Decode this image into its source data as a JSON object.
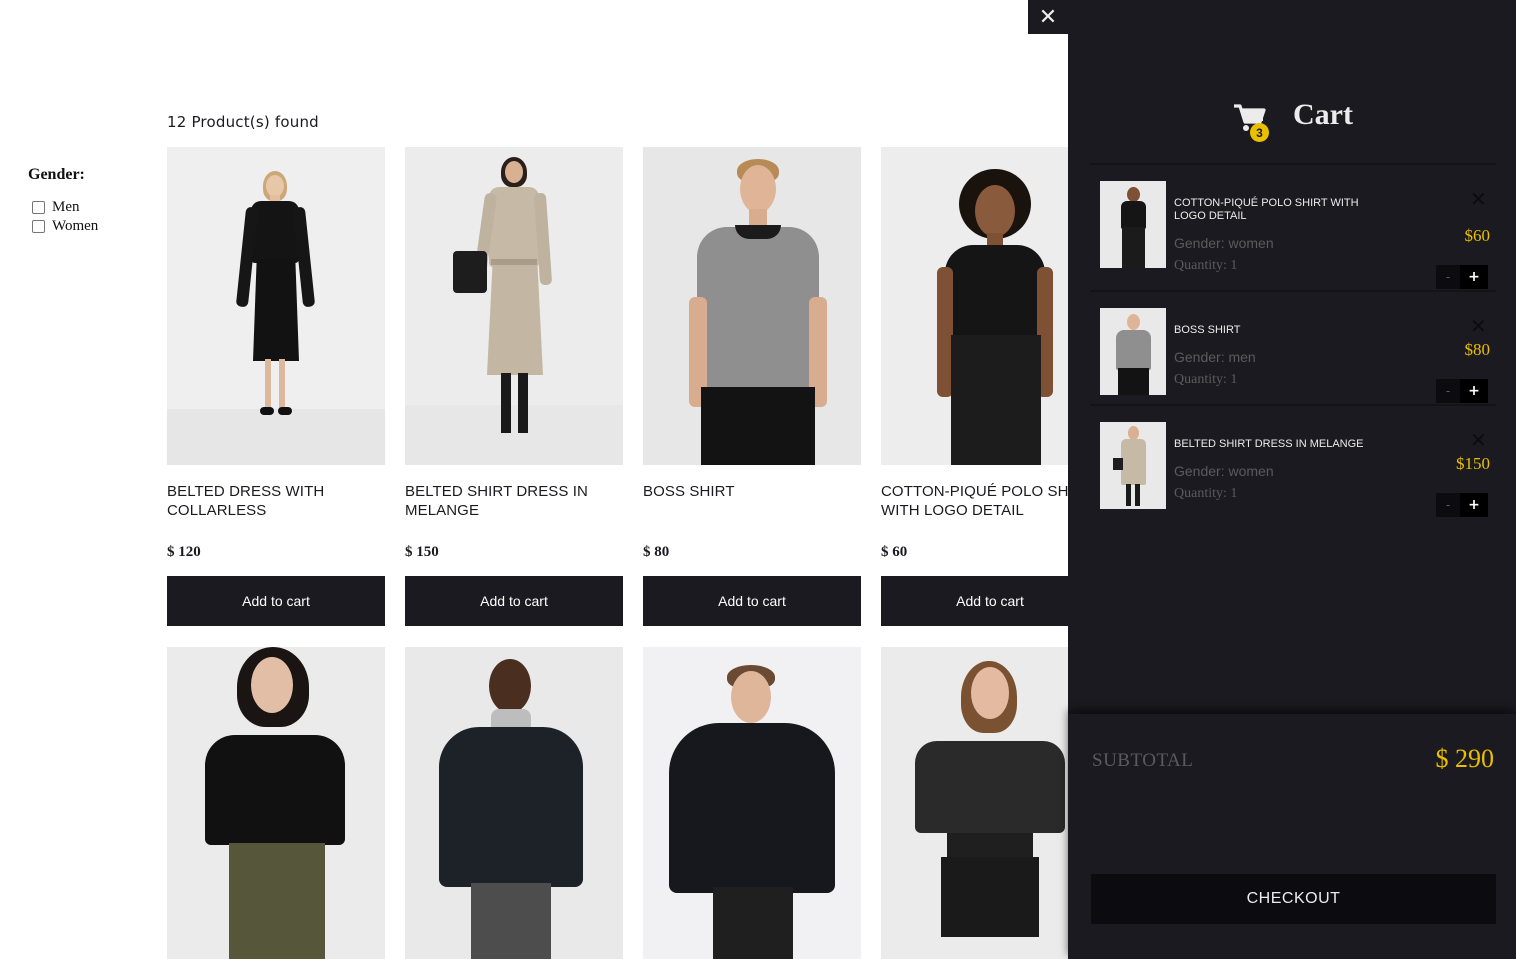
{
  "filter": {
    "title": "Gender:",
    "options": [
      "Men",
      "Women"
    ]
  },
  "products_found": "12 Product(s) found",
  "products": [
    {
      "title": "Belted dress with collarless",
      "price": "$ 120",
      "button": "Add to cart"
    },
    {
      "title": "Belted shirt dress in melange",
      "price": "$ 150",
      "button": "Add to cart"
    },
    {
      "title": "BOSS shirt",
      "price": "$ 80",
      "button": "Add to cart"
    },
    {
      "title": "Cotton-piqué polo shirt with logo detail",
      "price": "$ 60",
      "button": "Add to cart"
    }
  ],
  "cart": {
    "close_icon": "✕",
    "title": "Cart",
    "count": "3",
    "items": [
      {
        "title": "Cotton-piqué polo shirt with logo detail",
        "gender": "Gender: women",
        "quantity": "Quantity: 1",
        "price": "$60",
        "minus": "-",
        "plus": "+",
        "remove": "✕"
      },
      {
        "title": "BOSS shirt",
        "gender": "Gender: men",
        "quantity": "Quantity: 1",
        "price": "$80",
        "minus": "-",
        "plus": "+",
        "remove": "✕"
      },
      {
        "title": "Belted shirt dress in melange",
        "gender": "Gender: women",
        "quantity": "Quantity: 1",
        "price": "$150",
        "minus": "-",
        "plus": "+",
        "remove": "✕"
      }
    ],
    "subtotal_label": "SUBTOTAL",
    "subtotal_value": "$ 290",
    "checkout_label": "CHECKOUT"
  },
  "colors": {
    "dark": "#1b1a20",
    "accent": "#eabf00",
    "muted": "#5b5a5e"
  }
}
